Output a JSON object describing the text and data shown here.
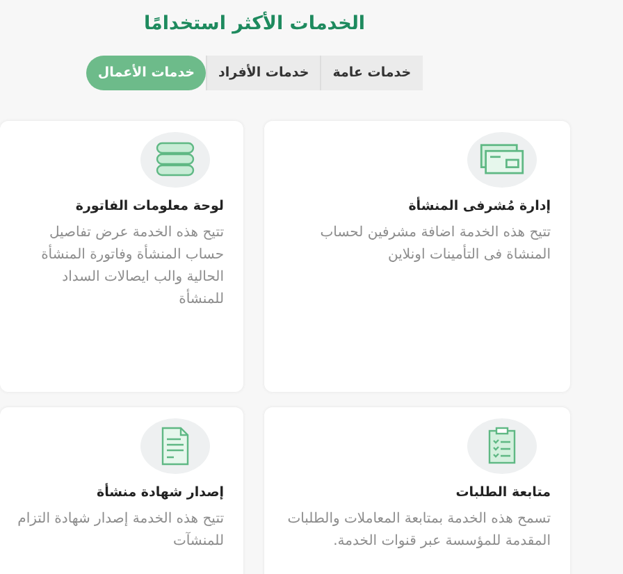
{
  "title": "الخدمات الأكثر استخدامًا",
  "tabs": [
    {
      "label": "خدمات عامة",
      "selected": false
    },
    {
      "label": "خدمات الأفراد",
      "selected": false
    },
    {
      "label": "خدمات الأعمال",
      "selected": true
    }
  ],
  "services": [
    {
      "title": "إدارة مُشرفى المنشأة",
      "description": "تتيح هذه الخدمة اضافة مشرفين لحساب المنشاة فى التأمينات اونلاين"
    },
    {
      "title": "لوحة معلومات الفاتورة",
      "description": "تتيح هذه الخدمة عرض تفاصيل حساب المنشأة وفاتورة المنشأة الحالية والب ايصالات السداد للمنشأة"
    },
    {
      "title": "متابعة الطلبات",
      "description": "تسمح هذه الخدمة بمتابعة المعاملات والطلبات المقدمة للمؤسسة عبر قنوات الخدمة."
    },
    {
      "title": "إصدار شهادة منشأة",
      "description": "تتيح هذه الخدمة إصدار شهادة التزام للمنشآت"
    }
  ]
}
